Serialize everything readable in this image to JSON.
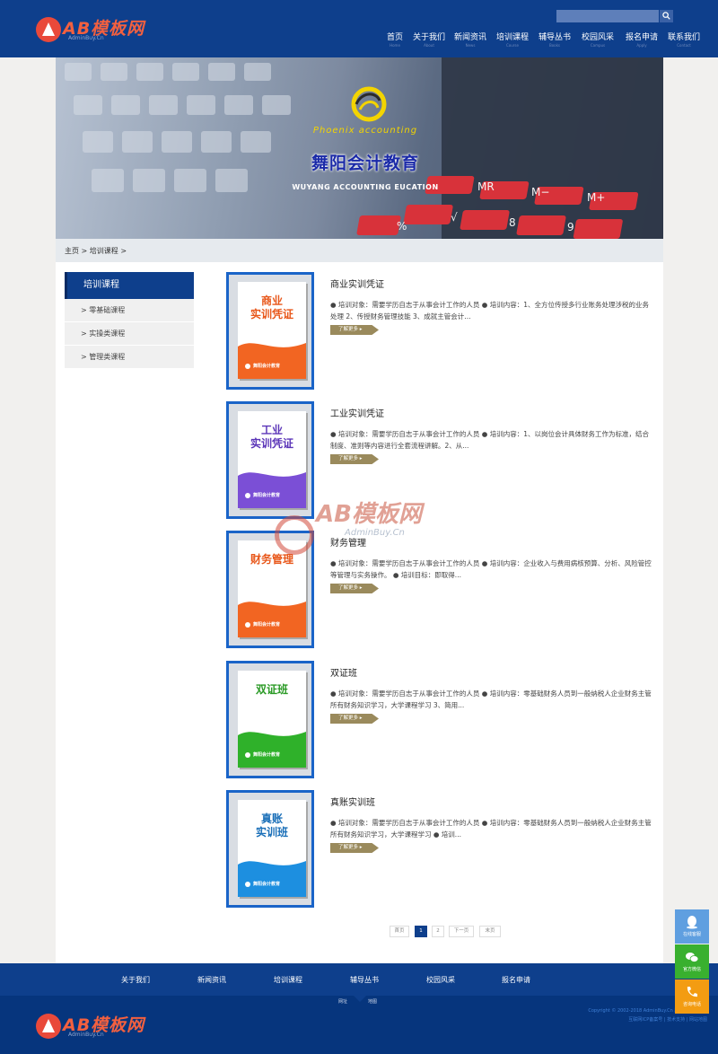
{
  "header": {
    "logo_text": "AB模板网",
    "logo_sub": "AdminBuy.Cn",
    "nav": [
      {
        "label": "首页",
        "sub": "Home"
      },
      {
        "label": "关于我们",
        "sub": "About"
      },
      {
        "label": "新闻资讯",
        "sub": "News"
      },
      {
        "label": "培训课程",
        "sub": "Course"
      },
      {
        "label": "辅导丛书",
        "sub": "Books"
      },
      {
        "label": "校园风采",
        "sub": "Campus"
      },
      {
        "label": "报名申请",
        "sub": "Apply"
      },
      {
        "label": "联系我们",
        "sub": "Contact"
      }
    ]
  },
  "banner": {
    "brand_en": "Phoenix accounting",
    "brand_cn": "舞阳会计教育",
    "brand_cn_en": "WUYANG ACCOUNTING EUCATION"
  },
  "breadcrumb": "主页 > 培训课程 >",
  "sidebar": {
    "title": "培训课程",
    "items": [
      "> 零基础课程",
      "> 实操类课程",
      "> 管理类课程"
    ]
  },
  "courses": [
    {
      "title": "商业实训凭证",
      "box_title": "商业\n实训凭证",
      "color": "#f26522",
      "title_color": "#e8571a",
      "desc": "● 培训对象：需要学历自志于从事会计工作的人员 ● 培训内容：1、全方位传授多行业账务处理涉税的业务处理 2、传授财务管理技能 3、成就主管会计..."
    },
    {
      "title": "工业实训凭证",
      "box_title": "工业\n实训凭证",
      "color": "#7b4fd6",
      "title_color": "#5b35b8",
      "desc": "● 培训对象：需要学历自志于从事会计工作的人员 ● 培训内容：1、以岗位会计具体财务工作为标准，结合制度、准则等内容进行全套流程讲解。2、从..."
    },
    {
      "title": "财务管理",
      "box_title": "财务管理",
      "color": "#f26522",
      "title_color": "#e8571a",
      "desc": "● 培训对象：需要学历自志于从事会计工作的人员 ● 培训内容：企业收入与费用病核预算、分析、风险管控等管理与实务操作。 ● 培训目标：即取得..."
    },
    {
      "title": "双证班",
      "box_title": "双证班",
      "color": "#2fb12a",
      "title_color": "#2a9a25",
      "desc": "● 培训对象：需要学历自志于从事会计工作的人员 ● 培训内容：零基础财务人员到一般纳税人企业财务主管所有财务知识学习，大学课程学习 3、简用..."
    },
    {
      "title": "真账实训班",
      "box_title": "真账\n实训班",
      "color": "#1d8fe0",
      "title_color": "#1a6fb8",
      "desc": "● 培训对象：需要学历自志于从事会计工作的人员 ● 培训内容：零基础财务人员到一般纳税人企业财务主管所有财务知识学习，大学课程学习 ● 培训..."
    }
  ],
  "box_footer": "舞阳会计教育",
  "more_label": "了解更多 ▸",
  "pager": {
    "first": "首页",
    "pages": [
      "1",
      "2"
    ],
    "next": "下一页",
    "last": "末页"
  },
  "footer": {
    "nav": [
      "关于我们",
      "新闻资讯",
      "培训课程",
      "辅导丛书",
      "校园风采",
      "报名申请"
    ],
    "qr_left": "网址",
    "qr_right": "地图",
    "copy1": "Copyright © 2002-2018 AdminBuy.Cn 版权所有 备案号",
    "copy2": "互联网ICP备案号 | 技术支持 | 网站地图"
  },
  "float": {
    "qq": "在线客服",
    "wx": "官方微信",
    "tel": "咨询电话"
  },
  "watermark": {
    "text": "AB模板网",
    "url": "AdminBuy.Cn"
  }
}
